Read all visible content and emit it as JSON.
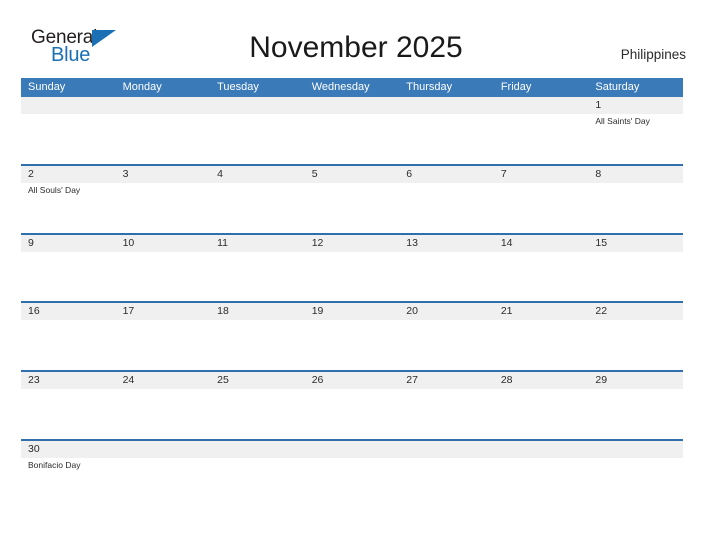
{
  "logo": {
    "word1": "General",
    "word2": "Blue",
    "flag_icon": "blue-triangle-flag"
  },
  "header": {
    "title": "November 2025",
    "country": "Philippines"
  },
  "colors": {
    "header_blue": "#3a7ab8",
    "row_divider_blue": "#2f6fad",
    "date_band_gray": "#f0f0f0",
    "logo_blue": "#1a6fb5",
    "text_dark": "#2b2b2b"
  },
  "calendar": {
    "weekdays": [
      "Sunday",
      "Monday",
      "Tuesday",
      "Wednesday",
      "Thursday",
      "Friday",
      "Saturday"
    ],
    "weeks": [
      {
        "band_columns": 7,
        "days": [
          {
            "number": "",
            "event": ""
          },
          {
            "number": "",
            "event": ""
          },
          {
            "number": "",
            "event": ""
          },
          {
            "number": "",
            "event": ""
          },
          {
            "number": "",
            "event": ""
          },
          {
            "number": "",
            "event": ""
          },
          {
            "number": "1",
            "event": "All Saints' Day"
          }
        ]
      },
      {
        "band_columns": 7,
        "days": [
          {
            "number": "2",
            "event": "All Souls' Day"
          },
          {
            "number": "3",
            "event": ""
          },
          {
            "number": "4",
            "event": ""
          },
          {
            "number": "5",
            "event": ""
          },
          {
            "number": "6",
            "event": ""
          },
          {
            "number": "7",
            "event": ""
          },
          {
            "number": "8",
            "event": ""
          }
        ]
      },
      {
        "band_columns": 7,
        "days": [
          {
            "number": "9",
            "event": ""
          },
          {
            "number": "10",
            "event": ""
          },
          {
            "number": "11",
            "event": ""
          },
          {
            "number": "12",
            "event": ""
          },
          {
            "number": "13",
            "event": ""
          },
          {
            "number": "14",
            "event": ""
          },
          {
            "number": "15",
            "event": ""
          }
        ]
      },
      {
        "band_columns": 7,
        "days": [
          {
            "number": "16",
            "event": ""
          },
          {
            "number": "17",
            "event": ""
          },
          {
            "number": "18",
            "event": ""
          },
          {
            "number": "19",
            "event": ""
          },
          {
            "number": "20",
            "event": ""
          },
          {
            "number": "21",
            "event": ""
          },
          {
            "number": "22",
            "event": ""
          }
        ]
      },
      {
        "band_columns": 7,
        "days": [
          {
            "number": "23",
            "event": ""
          },
          {
            "number": "24",
            "event": ""
          },
          {
            "number": "25",
            "event": ""
          },
          {
            "number": "26",
            "event": ""
          },
          {
            "number": "27",
            "event": ""
          },
          {
            "number": "28",
            "event": ""
          },
          {
            "number": "29",
            "event": ""
          }
        ]
      },
      {
        "band_columns": 7,
        "days": [
          {
            "number": "30",
            "event": "Bonifacio Day"
          },
          {
            "number": "",
            "event": ""
          },
          {
            "number": "",
            "event": ""
          },
          {
            "number": "",
            "event": ""
          },
          {
            "number": "",
            "event": ""
          },
          {
            "number": "",
            "event": ""
          },
          {
            "number": "",
            "event": ""
          }
        ]
      }
    ]
  }
}
